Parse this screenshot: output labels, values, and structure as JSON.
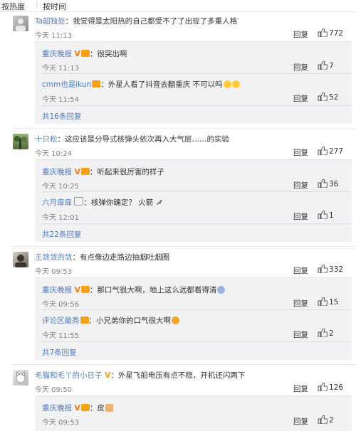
{
  "sort": {
    "hot": "按热度",
    "sep": "|",
    "time": "按时间"
  },
  "ui": {
    "reply_label": "回复"
  },
  "comments": [
    {
      "user": "Ta韶独处",
      "text": "：我觉得是太阳热的自己都受不了了出现了多重人格",
      "time": "今天 11:13",
      "likes": "772",
      "replies": [
        {
          "user": "重庆晚报",
          "verified": "V",
          "text": "：很突出啊",
          "time": "今天 11:13",
          "likes": "7"
        },
        {
          "user": "cmm也是ikun",
          "verified": "",
          "text": "：外星人看了抖音去翻重庆 不可以吗",
          "time": "今天 11:54",
          "likes": "52"
        }
      ],
      "more": "共16条回复"
    },
    {
      "user": "十只松",
      "text": "：这应该是分导式核弹头依次再入大气层……的实验",
      "time": "今天 10:24",
      "likes": "277",
      "replies": [
        {
          "user": "重庆晚报",
          "verified": "V",
          "text": "：听起来很厉害的样子",
          "time": "今天 10:25",
          "likes": "36"
        },
        {
          "user": "六月扉扉",
          "verified": "",
          "text": "：核弹你确定？ 火箭",
          "time": "今天 12:01",
          "likes": "1"
        }
      ],
      "more": "共22条回复"
    },
    {
      "user": "王敛敛的敛",
      "text": "：有点像边走路边抽烟吐烟圈",
      "time": "今天 09:53",
      "likes": "332",
      "replies": [
        {
          "user": "重庆晚报",
          "verified": "V",
          "text": "：那口气很大啊，地上这么远都看得清",
          "time": "今天 09:56",
          "likes": "15"
        },
        {
          "user": "评论区最秀",
          "verified": "",
          "text": "：小兄弟你的口气很大啊",
          "time": "今天 11:55",
          "likes": "2"
        }
      ],
      "more": "共7条回复"
    },
    {
      "user": "毛猫和毛丫的小日子",
      "text": "：外星飞船电压有点不稳，开机还闪两下",
      "time": "今天 09:50",
      "likes": "126",
      "replies": [
        {
          "user": "重庆晚报",
          "verified": "V",
          "text": "：皮",
          "time": "今天 09:53",
          "likes": "2"
        }
      ],
      "more": ""
    }
  ],
  "colors": {
    "link": "#4d7cc1",
    "reply_bg": "#f2f2f5",
    "muted": "#808080",
    "verified": "#f77c0f"
  }
}
